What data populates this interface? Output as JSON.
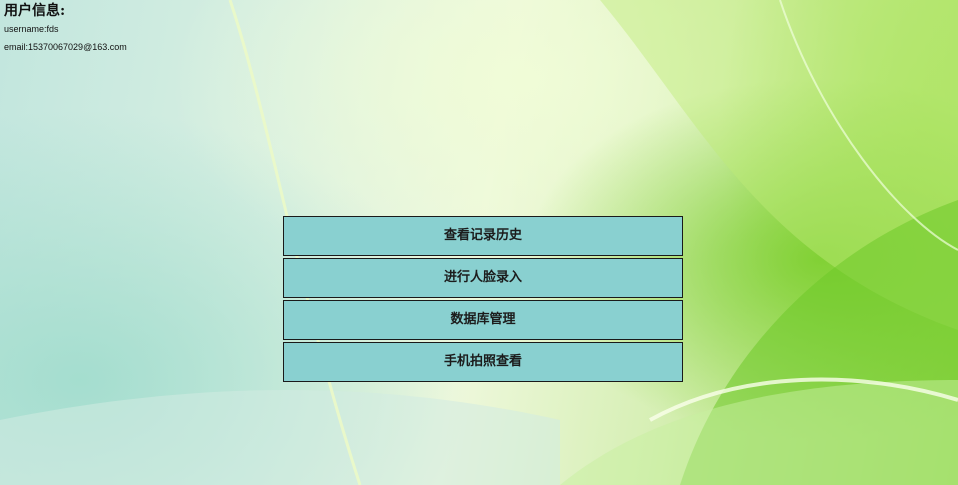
{
  "user_info": {
    "title": "用户信息:",
    "username_line": "username:fds",
    "email_line": "email:15370067029@163.com"
  },
  "menu": {
    "buttons": [
      {
        "label": "查看记录历史"
      },
      {
        "label": "进行人脸录入"
      },
      {
        "label": "数据库管理"
      },
      {
        "label": "手机拍照查看"
      }
    ]
  },
  "colors": {
    "button_background": "#89d0d0",
    "button_border": "#1a1a1a"
  }
}
